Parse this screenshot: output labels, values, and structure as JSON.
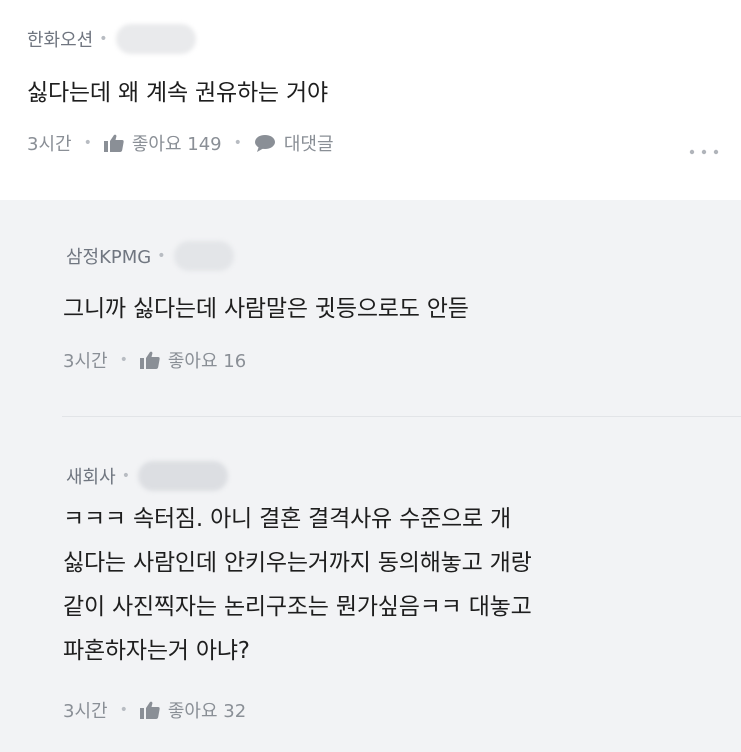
{
  "comment": {
    "author": "한화오션",
    "text": "싫다는데 왜 계속 권유하는 거야",
    "time": "3시간",
    "like_label": "좋아요 149",
    "reply_label": "대댓글"
  },
  "replies": [
    {
      "author": "삼정KPMG",
      "text_lines": [
        "그니까 싫다는데 사람말은 귓등으로도 안듣"
      ],
      "time": "3시간",
      "like_label": "좋아요 16"
    },
    {
      "author": "새회사",
      "text_lines": [
        "ㅋㅋㅋ 속터짐. 아니 결혼 결격사유 수준으로 개",
        "싫다는 사람인데  안키우는거까지 동의해놓고 개랑",
        "같이 사진찍자는 논리구조는 뭔가싶음ㅋㅋ 대놓고",
        "파혼하자는거 아냐?"
      ],
      "time": "3시간",
      "like_label": "좋아요 32"
    }
  ],
  "icons": {
    "like": "thumbs-up-icon",
    "reply": "speech-bubble-icon",
    "more": "more-dots-icon"
  },
  "colors": {
    "reply_background": "#f2f3f5",
    "meta_text": "#8a8f96",
    "body_text": "#1e1e1e"
  }
}
